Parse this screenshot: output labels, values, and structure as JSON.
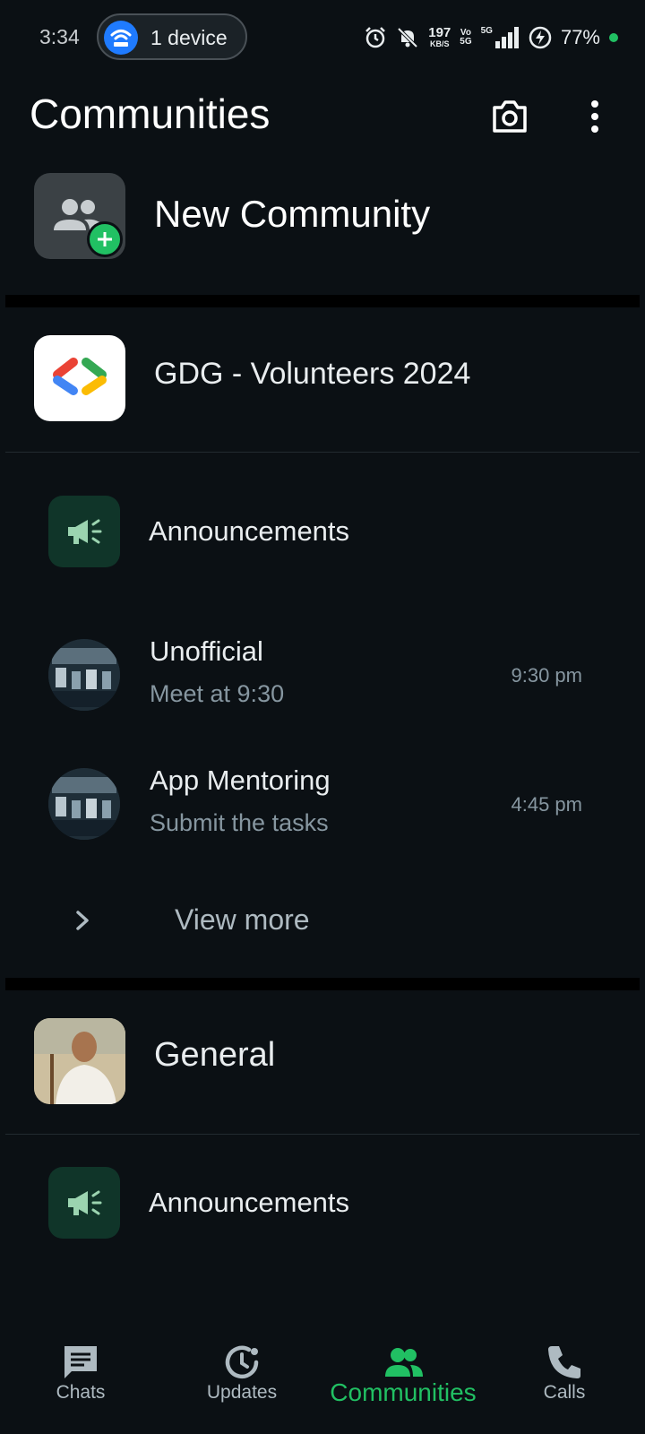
{
  "status_bar": {
    "time": "3:34",
    "hotspot_label": "1 device",
    "net_speed_value": "197",
    "net_speed_unit": "KB/S",
    "volte": "Vo\n5G",
    "signal_type": "5G",
    "battery": "77%",
    "icons": [
      "alarm-icon",
      "notifications-off-icon",
      "signal-icon",
      "battery-charging-icon"
    ]
  },
  "header": {
    "title": "Communities",
    "actions": [
      "camera-icon",
      "more-vert-icon"
    ]
  },
  "new_community": {
    "label": "New Community"
  },
  "communities": [
    {
      "name": "GDG - Volunteers 2024",
      "announcements_label": "Announcements",
      "groups": [
        {
          "name": "Unofficial",
          "last_message": "Meet at 9:30",
          "time": "9:30 pm"
        },
        {
          "name": "App Mentoring",
          "last_message": "Submit the tasks",
          "time": "4:45 pm"
        }
      ],
      "view_more_label": "View more"
    },
    {
      "name": "General",
      "announcements_label": "Announcements"
    }
  ],
  "bottom_nav": {
    "items": [
      {
        "label": "Chats",
        "icon": "chat-icon",
        "active": false
      },
      {
        "label": "Updates",
        "icon": "updates-icon",
        "active": false
      },
      {
        "label": "Communities",
        "icon": "communities-icon",
        "active": true
      },
      {
        "label": "Calls",
        "icon": "phone-icon",
        "active": false
      }
    ]
  },
  "colors": {
    "background": "#0b1014",
    "accent": "#21c063",
    "announcement_tile": "#103529",
    "secondary_text": "#8696a0"
  }
}
